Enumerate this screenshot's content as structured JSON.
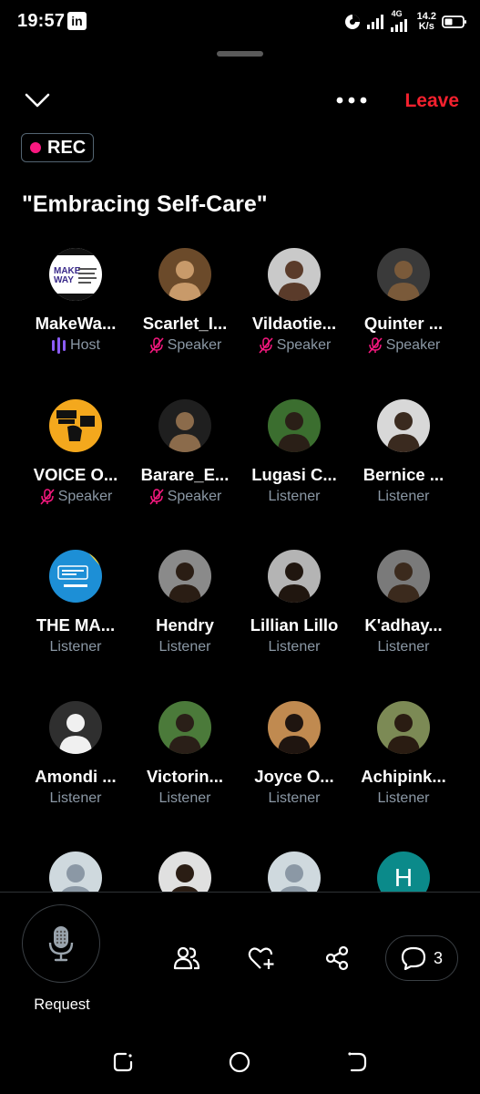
{
  "status_bar": {
    "time": "19:57",
    "app_badge": "in",
    "network": "4G",
    "speed_value": "14.2",
    "speed_unit": "K/s"
  },
  "header": {
    "leave_label": "Leave",
    "rec_label": "REC"
  },
  "space": {
    "title": "\"Embracing Self-Care\""
  },
  "participants": [
    {
      "name": "MakeWa...",
      "role": "Host",
      "role_icon": "host-icon",
      "avatar": "logo-makeway"
    },
    {
      "name": "Scarlet_I...",
      "role": "Speaker",
      "role_icon": "mic-muted-icon",
      "avatar": "photo"
    },
    {
      "name": "Vildaotie...",
      "role": "Speaker",
      "role_icon": "mic-muted-icon",
      "avatar": "photo"
    },
    {
      "name": "Quinter ...",
      "role": "Speaker",
      "role_icon": "mic-muted-icon",
      "avatar": "photo"
    },
    {
      "name": "VOICE O...",
      "role": "Speaker",
      "role_icon": "mic-muted-icon",
      "avatar": "logo-voice"
    },
    {
      "name": "Barare_E...",
      "role": "Speaker",
      "role_icon": "mic-muted-icon",
      "avatar": "photo"
    },
    {
      "name": "Lugasi C...",
      "role": "Listener",
      "role_icon": "",
      "avatar": "photo"
    },
    {
      "name": "Bernice ...",
      "role": "Listener",
      "role_icon": "",
      "avatar": "photo"
    },
    {
      "name": "THE MA...",
      "role": "Listener",
      "role_icon": "",
      "avatar": "logo-youth-panel"
    },
    {
      "name": "Hendry",
      "role": "Listener",
      "role_icon": "",
      "avatar": "photo"
    },
    {
      "name": "Lillian Lillo",
      "role": "Listener",
      "role_icon": "",
      "avatar": "photo"
    },
    {
      "name": "K'adhay...",
      "role": "Listener",
      "role_icon": "",
      "avatar": "photo"
    },
    {
      "name": "Amondi ...",
      "role": "Listener",
      "role_icon": "",
      "avatar": "photo"
    },
    {
      "name": "Victorin...",
      "role": "Listener",
      "role_icon": "",
      "avatar": "photo"
    },
    {
      "name": "Joyce O...",
      "role": "Listener",
      "role_icon": "",
      "avatar": "photo"
    },
    {
      "name": "Achipink...",
      "role": "Listener",
      "role_icon": "",
      "avatar": "photo"
    },
    {
      "name": "",
      "role": "",
      "role_icon": "",
      "avatar": "default-silhouette"
    },
    {
      "name": "",
      "role": "",
      "role_icon": "",
      "avatar": "photo"
    },
    {
      "name": "",
      "role": "",
      "role_icon": "",
      "avatar": "default-silhouette"
    },
    {
      "name": "",
      "role": "",
      "role_icon": "",
      "avatar": "initial",
      "initial": "H"
    }
  ],
  "toolbar": {
    "request_label": "Request",
    "comments_count": "3"
  },
  "colors": {
    "leave": "#f4212e",
    "rec_dot": "#f91880",
    "host_icon": "#8b5cf6",
    "muted_icon": "#f91880",
    "secondary_text": "#8b98a5",
    "initial_avatar": "#0b8a8a"
  }
}
